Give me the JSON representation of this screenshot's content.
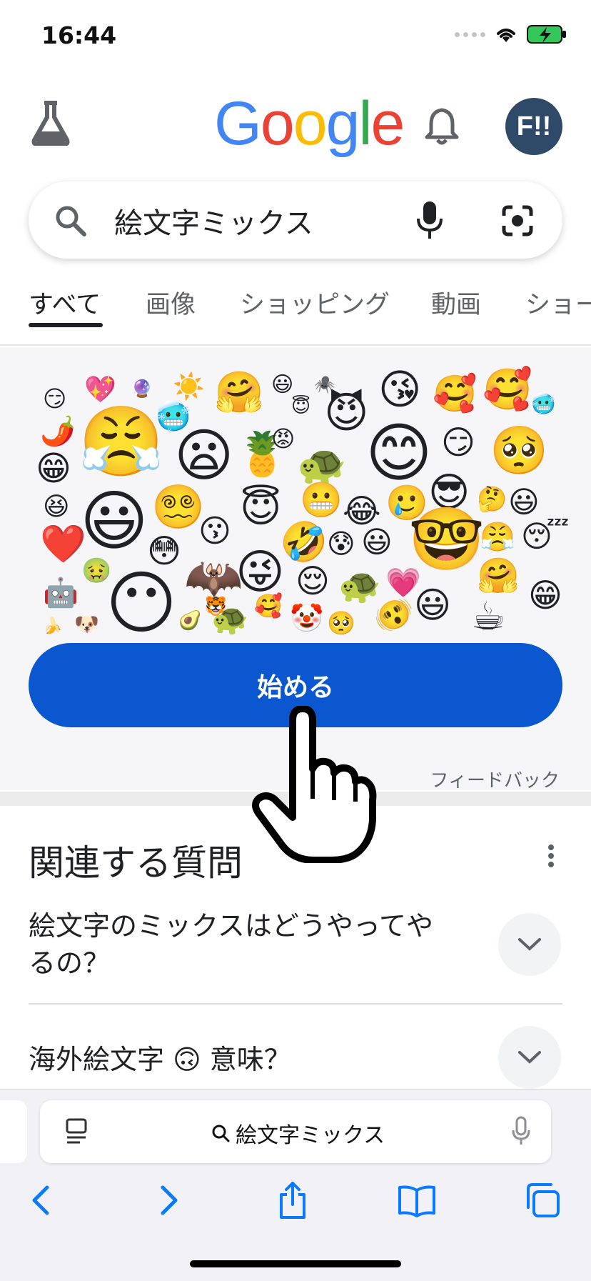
{
  "status_bar": {
    "time": "16:44"
  },
  "header": {
    "logo": [
      "G",
      "o",
      "o",
      "g",
      "l",
      "e"
    ],
    "avatar_text": "F!!"
  },
  "search": {
    "query": "絵文字ミックス"
  },
  "tabs": [
    {
      "label": "すべて",
      "active": true
    },
    {
      "label": "画像",
      "active": false
    },
    {
      "label": "ショッピング",
      "active": false
    },
    {
      "label": "動画",
      "active": false
    },
    {
      "label": "ショー",
      "active": false
    }
  ],
  "emoji_card": {
    "start_button": "始める",
    "feedback": "フィードバック"
  },
  "related_questions": {
    "title": "関連する質問",
    "items": [
      {
        "question": "絵文字のミックスはどうやってやるの？"
      },
      {
        "question": "海外絵文字 🙃 意味？"
      }
    ]
  },
  "safari": {
    "address_text": "絵文字ミックス"
  },
  "colors": {
    "primary_button": "#0b57d0",
    "avatar_bg": "#2f4a68"
  }
}
